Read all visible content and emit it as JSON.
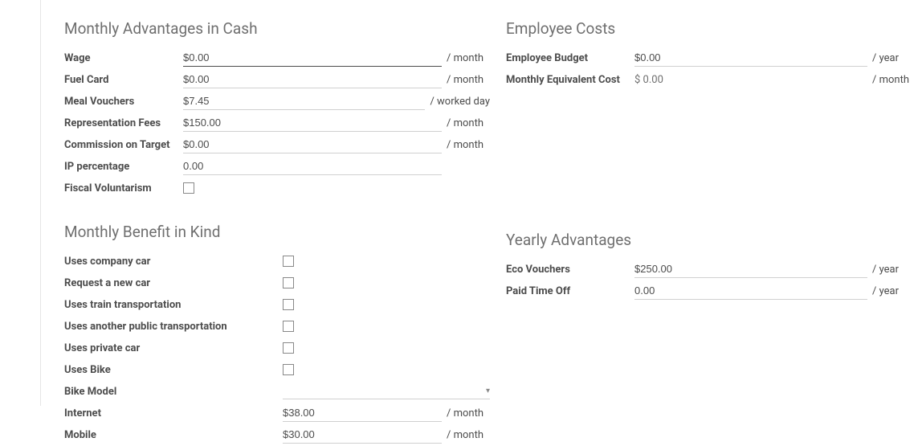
{
  "left": {
    "cash": {
      "title": "Monthly Advantages in Cash",
      "wage": {
        "label": "Wage",
        "value": "$0.00",
        "suffix": "/ month"
      },
      "fuel": {
        "label": "Fuel Card",
        "value": "$0.00",
        "suffix": "/ month"
      },
      "meal": {
        "label": "Meal Vouchers",
        "value": "$7.45",
        "suffix": "/ worked day"
      },
      "repfees": {
        "label": "Representation Fees",
        "value": "$150.00",
        "suffix": "/ month"
      },
      "commission": {
        "label": "Commission on Target",
        "value": "$0.00",
        "suffix": "/ month"
      },
      "ip": {
        "label": "IP percentage",
        "value": "0.00"
      },
      "fiscal": {
        "label": "Fiscal Voluntarism"
      }
    },
    "bik": {
      "title": "Monthly Benefit in Kind",
      "car": "Uses company car",
      "newcar": "Request a new car",
      "train": "Uses train transportation",
      "public": "Uses another public transportation",
      "private": "Uses private car",
      "bike": "Uses Bike",
      "bikemodel": "Bike Model",
      "internet": {
        "label": "Internet",
        "value": "$38.00",
        "suffix": "/ month"
      },
      "mobile": {
        "label": "Mobile",
        "value": "$30.00",
        "suffix": "/ month"
      }
    }
  },
  "right": {
    "costs": {
      "title": "Employee Costs",
      "budget": {
        "label": "Employee Budget",
        "value": "$0.00",
        "suffix": "/ year"
      },
      "monthly": {
        "label": "Monthly Equivalent Cost",
        "value": "$ 0.00",
        "suffix": "/ month"
      }
    },
    "yearly": {
      "title": "Yearly Advantages",
      "eco": {
        "label": "Eco Vouchers",
        "value": "$250.00",
        "suffix": "/ year"
      },
      "pto": {
        "label": "Paid Time Off",
        "value": "0.00",
        "suffix": "/ year"
      }
    }
  }
}
